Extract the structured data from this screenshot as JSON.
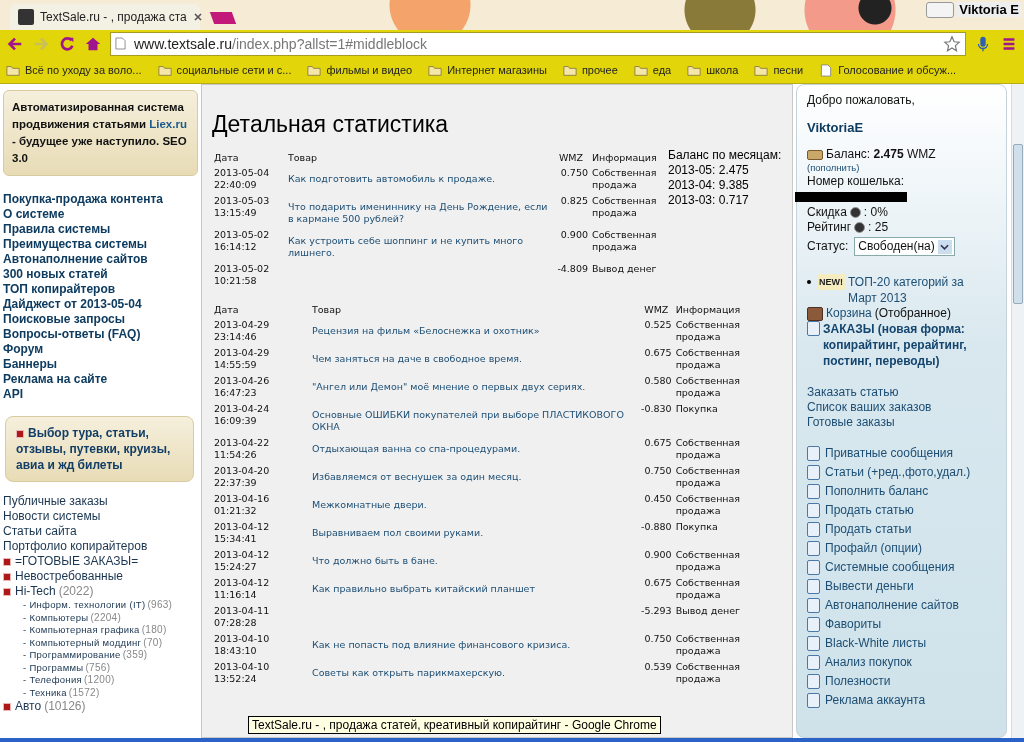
{
  "browser": {
    "tab_title": "TextSale.ru - , продажа ста",
    "user": "Viktoria E",
    "url_host": "www.textsale.ru",
    "url_path": "/index.php?allst=1#middleblock",
    "forward_disabled": true,
    "bookmarks": [
      {
        "kind": "folder",
        "label": "Всё по уходу за воло..."
      },
      {
        "kind": "folder",
        "label": "социальные сети и с..."
      },
      {
        "kind": "folder",
        "label": "фильмы и видео"
      },
      {
        "kind": "folder",
        "label": "Интернет магазины"
      },
      {
        "kind": "folder",
        "label": "прочее"
      },
      {
        "kind": "folder",
        "label": "еда"
      },
      {
        "kind": "folder",
        "label": "школа"
      },
      {
        "kind": "folder",
        "label": "песни"
      },
      {
        "kind": "page",
        "label": "Голосование и обсуж..."
      }
    ]
  },
  "left": {
    "promo": {
      "before": "Автоматизированная система продвижения статьями",
      "link": "Liex.ru",
      "after": "- будущее уже наступило. SEO 3.0"
    },
    "main_links": [
      "Покупка-продажа контента",
      "О системе",
      "Правила системы",
      "Преимущества системы",
      "Автонаполнение сайтов",
      "300 новых статей",
      "ТОП копирайтеров",
      "Дайджест от 2013-05-04",
      "Поисковые запросы",
      "Вопросы-ответы (FAQ)",
      "Форум",
      "Баннеры",
      "Реклама на сайте",
      "API"
    ],
    "tour_box": "Выбор тура, статьи, отзывы, путевки, круизы, авиа и жд билеты",
    "plain_links": [
      "Публичные заказы",
      "Новости системы",
      "Статьи сайта",
      "Портфолио копирайтеров"
    ],
    "categories": [
      {
        "label": "=ГОТОВЫЕ ЗАКАЗЫ="
      },
      {
        "label": "Невостребованные"
      },
      {
        "label": "Hi-Tech",
        "count": "(2022)",
        "children": [
          {
            "label": "- Информ. технологии (IT)",
            "count": "(963)"
          },
          {
            "label": "- Компьютеры",
            "count": "(2204)"
          },
          {
            "label": "- Компьютерная графика",
            "count": "(180)"
          },
          {
            "label": "- Компьютерный моддинг",
            "count": "(70)"
          },
          {
            "label": "- Программирование",
            "count": "(359)"
          },
          {
            "label": "- Программы",
            "count": "(756)"
          },
          {
            "label": "- Телефония",
            "count": "(1200)"
          },
          {
            "label": "- Техника",
            "count": "(1572)"
          }
        ]
      },
      {
        "label": "Авто",
        "count": "(10126)"
      }
    ]
  },
  "main": {
    "title": "Детальная статистика",
    "columns": [
      "Дата",
      "Товар",
      "WMZ",
      "Информация"
    ],
    "recent": [
      {
        "date": "2013-05-04 22:40:09",
        "item": "Как подготовить автомобиль к продаже.",
        "wmz": "0.750",
        "info": "Собственная продажа"
      },
      {
        "date": "2013-05-03 13:15:49",
        "item": "Что подарить имениннику на День Рождение, если в кармане 500 рублей?",
        "wmz": "0.825",
        "info": "Собственная продажа"
      },
      {
        "date": "2013-05-02 16:14:12",
        "item": "Как устроить себе шоппинг и не купить много лишнего.",
        "wmz": "0.900",
        "info": "Собственная продажа"
      },
      {
        "date": "2013-05-02 10:21:58",
        "wmz": "-4.809",
        "info": "Вывод денег"
      }
    ],
    "columns2": [
      "Дата",
      "Товар",
      "WMZ",
      "Информация"
    ],
    "balance_title": "Баланс по месяцам:",
    "balances": [
      "2013-05: 2.475",
      "2013-04: 9.385",
      "2013-03: 0.717"
    ],
    "history": [
      {
        "date": "2013-04-29 23:14:46",
        "item": "Рецензия на фильм «Белоснежка и охотник»",
        "wmz": "0.525",
        "info": "Собственная продажа"
      },
      {
        "date": "2013-04-29 14:55:59",
        "item": "Чем заняться на даче в свободное время.",
        "wmz": "0.675",
        "info": "Собственная продажа"
      },
      {
        "date": "2013-04-26 16:47:23",
        "item": "\"Ангел или Демон\" моё мнение о первых двух сериях.",
        "wmz": "0.580",
        "info": "Собственная продажа"
      },
      {
        "date": "2013-04-24 16:09:39",
        "item": "Основные ОШИБКИ покупателей при выборе ПЛАСТИКОВОГО ОКНА",
        "wmz": "-0.830",
        "info": "Покупка"
      },
      {
        "date": "2013-04-22 11:54:26",
        "item": "Отдыхающая ванна со спа-процедурами.",
        "wmz": "0.675",
        "info": "Собственная продажа"
      },
      {
        "date": "2013-04-20 22:37:39",
        "item": "Избавляемся от веснушек за один месяц.",
        "wmz": "0.750",
        "info": "Собственная продажа"
      },
      {
        "date": "2013-04-16 01:21:32",
        "item": "Межкомнатные двери.",
        "wmz": "0.450",
        "info": "Собственная продажа"
      },
      {
        "date": "2013-04-12 15:34:41",
        "item": "Выравниваем пол своими руками.",
        "wmz": "-0.880",
        "info": "Покупка"
      },
      {
        "date": "2013-04-12 15:24:27",
        "item": "Что должно быть в бане.",
        "wmz": "0.900",
        "info": "Собственная продажа"
      },
      {
        "date": "2013-04-12 11:16:14",
        "item": "Как правильно выбрать китайский планшет",
        "wmz": "0.675",
        "info": "Собственная продажа"
      },
      {
        "date": "2013-04-11 07:28:28",
        "wmz": "-5.293",
        "info": "Вывод денег"
      },
      {
        "date": "2013-04-10 18:43:10",
        "item": "Как не попасть под влияние финансового кризиса.",
        "wmz": "0.750",
        "info": "Собственная продажа"
      },
      {
        "date": "2013-04-10 13:52:24",
        "item": "Советы как открыть парикмахерскую.",
        "wmz": "0.539",
        "info": "Собственная продажа"
      }
    ]
  },
  "right": {
    "welcome": "Добро пожаловать,",
    "username": "ViktoriaE",
    "balance": "Баланс: **2.475** WMZ",
    "topup": "(пополнить)",
    "wallet_label": "Номер кошелька:",
    "discount_label": "Скидка",
    "discount_value": ": 0%",
    "rating_label": "Рейтинг",
    "rating_value": ": 25",
    "status_label": "Статус:",
    "status_value": "Свободен(на)",
    "new_badge": "NEW!",
    "top_link": "ТОП-20 категорий за Март 2013",
    "cart_link": "Корзина",
    "cart_note": "(Отобранное)",
    "orders_link": "ЗАКАЗЫ (новая форма: копирайтинг, рерайтинг, постинг, переводы)",
    "order_links": [
      "Заказать статью",
      "Список ваших заказов",
      "Готовые заказы"
    ],
    "menu": [
      "Приватные сообщения",
      "Статьи (+ред.,фото,удал.)",
      "Пополнить баланс",
      "Продать статью",
      "Продать статьи",
      "Профайл (опции)",
      "Системные сообщения",
      "Вывести деньги",
      "Автонаполнение сайтов",
      "Фавориты",
      "Black-White листы",
      "Анализ покупок",
      "Полезности",
      "Реклама аккаунта"
    ]
  },
  "tooltip": "TextSale.ru - , продажа статей, креативный копирайтинг - Google Chrome"
}
